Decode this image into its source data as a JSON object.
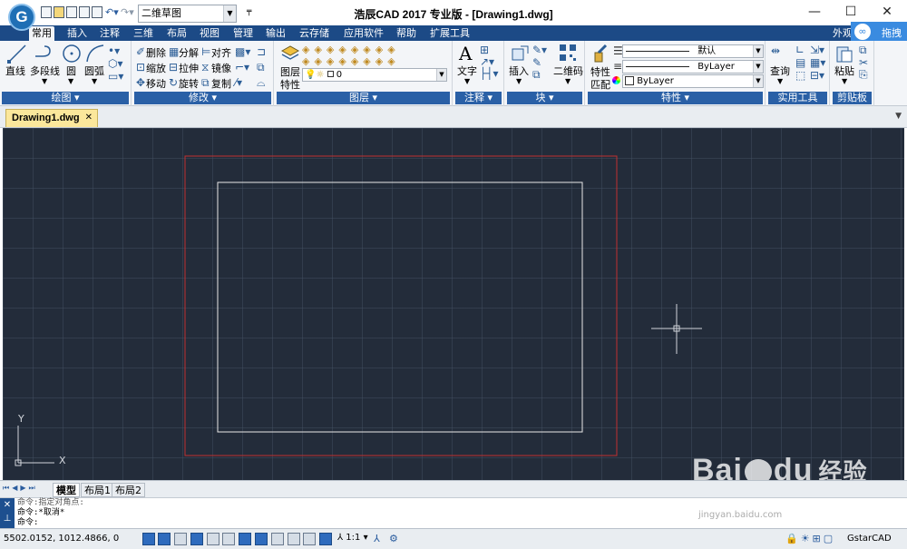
{
  "window": {
    "title": "浩辰CAD 2017 专业版 - [Drawing1.dwg]",
    "app_logo_letter": "G",
    "minimize": "—",
    "maximize": "☐",
    "close": "✕"
  },
  "quick_access": {
    "workspace": "二维草图"
  },
  "menu": {
    "tabs": [
      "常用",
      "插入",
      "注释",
      "三维",
      "布局",
      "视图",
      "管理",
      "输出",
      "云存储",
      "应用软件",
      "帮助",
      "扩展工具"
    ],
    "active_tab": "常用",
    "right_text": "外观",
    "cloud_button": "拖拽"
  },
  "ribbon": {
    "draw": {
      "label": "绘图",
      "line": "直线",
      "polyline": "多段线",
      "circle": "圆",
      "arc": "圆弧"
    },
    "modify": {
      "label": "修改",
      "erase": "删除",
      "explode": "分解",
      "align": "对齐",
      "scale": "缩放",
      "stretch": "拉伸",
      "mirror": "镜像",
      "move": "移动",
      "rotate": "旋转",
      "copy": "复制"
    },
    "layers": {
      "label": "图层",
      "props_line1": "图层",
      "props_line2": "特性",
      "current_layer": "0"
    },
    "annotation": {
      "label": "注释",
      "text": "文字"
    },
    "block": {
      "label": "块",
      "insert": "插入",
      "qrcode": "二维码"
    },
    "properties": {
      "label": "特性",
      "match_line1": "特性",
      "match_line2": "匹配",
      "linetype": "默认",
      "lineweight": "ByLayer",
      "color": "ByLayer"
    },
    "utilities": {
      "label": "实用工具",
      "query": "查询"
    },
    "clipboard": {
      "label": "剪贴板",
      "paste": "粘贴"
    }
  },
  "document_tab": {
    "name": "Drawing1.dwg",
    "close": "✕"
  },
  "canvas": {
    "ucs_y": "Y",
    "ucs_x": "X",
    "colors": {
      "background": "#232c3a",
      "red_rect": "#c03030",
      "white_rect": "#e8e8e8"
    }
  },
  "layout_tabs": {
    "nav": [
      "⏮",
      "◀",
      "▶",
      "⏭"
    ],
    "tabs": [
      "模型",
      "布局1",
      "布局2"
    ],
    "active": "模型"
  },
  "command": {
    "lines": [
      "命令:指定对角点:",
      "命令:*取消*",
      "命令:"
    ]
  },
  "status": {
    "coords": "5502.0152, 1012.4866, 0",
    "scale": "1:1",
    "brand": "GstarCAD"
  },
  "watermark": {
    "logo": "Bai",
    "logo_tail": "du",
    "text": "经验",
    "url": "jingyan.baidu.com"
  }
}
